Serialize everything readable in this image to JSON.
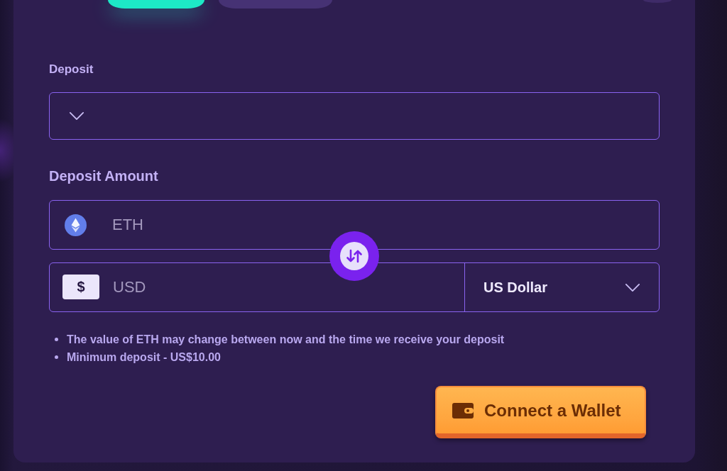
{
  "tabs": [
    {
      "selected": true
    },
    {
      "selected": false
    }
  ],
  "deposit": {
    "label": "Deposit"
  },
  "deposit_amount": {
    "label": "Deposit Amount",
    "crypto_input": {
      "placeholder": "ETH"
    },
    "fiat_input": {
      "symbol": "$",
      "placeholder": "USD"
    },
    "currency_select": {
      "value": "US Dollar"
    }
  },
  "notes": [
    "The value of ETH may change between now and the time we receive your deposit",
    "Minimum deposit - US$10.00"
  ],
  "connect_button": {
    "label": "Connect a Wallet"
  }
}
